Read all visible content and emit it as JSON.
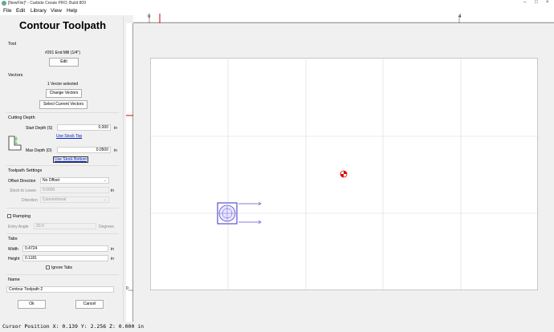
{
  "window": {
    "title": "[NewFile]* - Carbide Create PRO; Build 809"
  },
  "menu": [
    "File",
    "Edit",
    "Library",
    "View",
    "Help"
  ],
  "panel": {
    "title": "Contour Toolpath",
    "tool": {
      "heading": "Tool",
      "name": "#201 End Mill (1/4\")",
      "edit_label": "Edit"
    },
    "vectors": {
      "heading": "Vectors",
      "selected": "1 Vector selected",
      "change_label": "Change Vectors",
      "select_current_label": "Select Current Vectors"
    },
    "cutting_depth": {
      "heading": "Cutting Depth",
      "start_label": "Start Depth (S)",
      "start_value": "0.000",
      "start_unit": "in",
      "use_stock_top": "Use Stock Top",
      "max_label": "Max Depth (D)",
      "max_value": "0.0500",
      "max_unit": "in",
      "use_stock_bottom": "Use Stock Bottom"
    },
    "toolpath_settings": {
      "heading": "Toolpath Settings",
      "offset_label": "Offset Direction",
      "offset_value": "No Offset",
      "stock_label": "Stock to Leave",
      "stock_value": "0.0000",
      "stock_unit": "in",
      "direction_label": "Direction",
      "direction_value": "Conventional"
    },
    "ramping": {
      "label": "Ramping",
      "entry_label": "Entry Angle",
      "entry_value": "20.0",
      "entry_unit": "Degrees"
    },
    "tabs": {
      "heading": "Tabs",
      "width_label": "Width",
      "width_value": "0.4724",
      "width_unit": "in",
      "height_label": "Height",
      "height_value": "0.1181",
      "height_unit": "in",
      "ignore_label": "Ignore Tabs"
    },
    "name": {
      "heading": "Name",
      "value": "Contour Toolpath 2"
    },
    "ok_label": "Ok",
    "cancel_label": "Cancel"
  },
  "rulers": {
    "top_zero": "0",
    "top_four": "4",
    "left_zero": "0"
  },
  "status": {
    "text": "Cursor Position X: 0.139 Y: 2.256 Z: 0.000 in"
  },
  "colors": {
    "selection": "#5a4fcf",
    "origin_marker": "#e00000",
    "ruler_marker": "#d00000"
  }
}
